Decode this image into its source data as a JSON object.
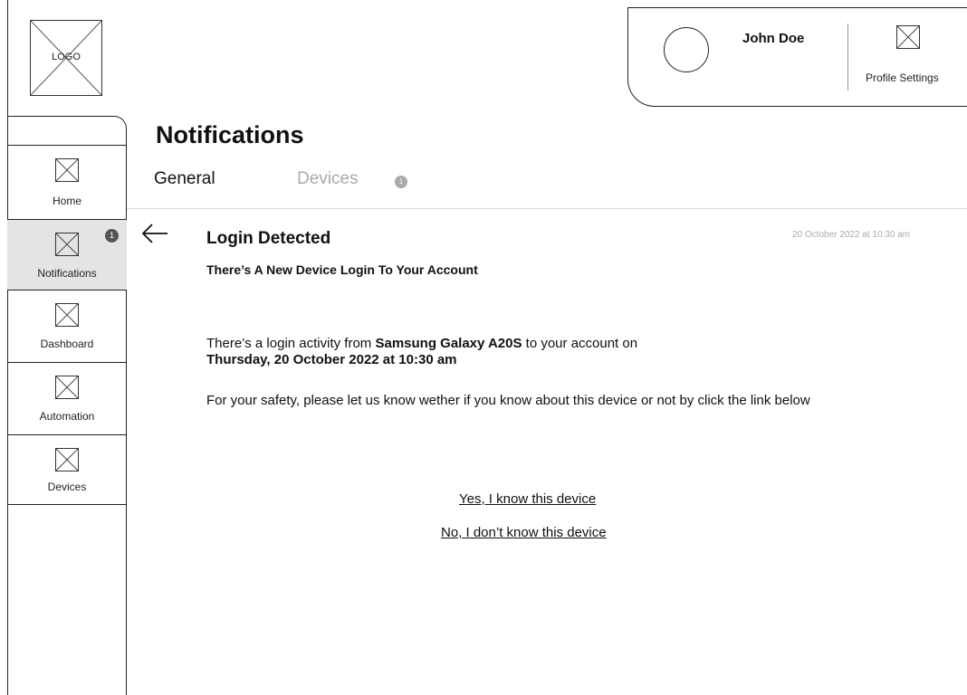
{
  "logo": {
    "label": "LOGO"
  },
  "user": {
    "name": "John Doe",
    "profile_settings_label": "Profile Settings"
  },
  "sidebar": {
    "items": [
      {
        "label": "Home",
        "icon": "image-placeholder-icon",
        "active": false
      },
      {
        "label": "Notifications",
        "icon": "image-placeholder-icon",
        "active": true,
        "badge": "1"
      },
      {
        "label": "Dashboard",
        "icon": "image-placeholder-icon",
        "active": false
      },
      {
        "label": "Automation",
        "icon": "image-placeholder-icon",
        "active": false
      },
      {
        "label": "Devices",
        "icon": "image-placeholder-icon",
        "active": false
      }
    ]
  },
  "page": {
    "title": "Notifications",
    "tabs": [
      {
        "label": "General",
        "active": true
      },
      {
        "label": "Devices",
        "active": false,
        "badge": "1"
      }
    ]
  },
  "message": {
    "title": "Login Detected",
    "date": "20 October 2022 at 10:30 am",
    "subtitle": "There’s A New Device Login To Your Account",
    "para1_pre": "There’s a login activity from ",
    "para1_device": "Samsung Galaxy A20S",
    "para1_mid": " to your account on ",
    "para1_datetime": "Thursday, 20 October 2022 at 10:30 am",
    "para2": "For your safety, please let us know wether if you know about this device or not by click the link below",
    "link_yes": "Yes, I know this device",
    "link_no": "No, I don’t know this device"
  },
  "colors": {
    "active_bg": "#e4e4e4",
    "muted_text": "#aaaaaa",
    "badge": "#555555"
  }
}
